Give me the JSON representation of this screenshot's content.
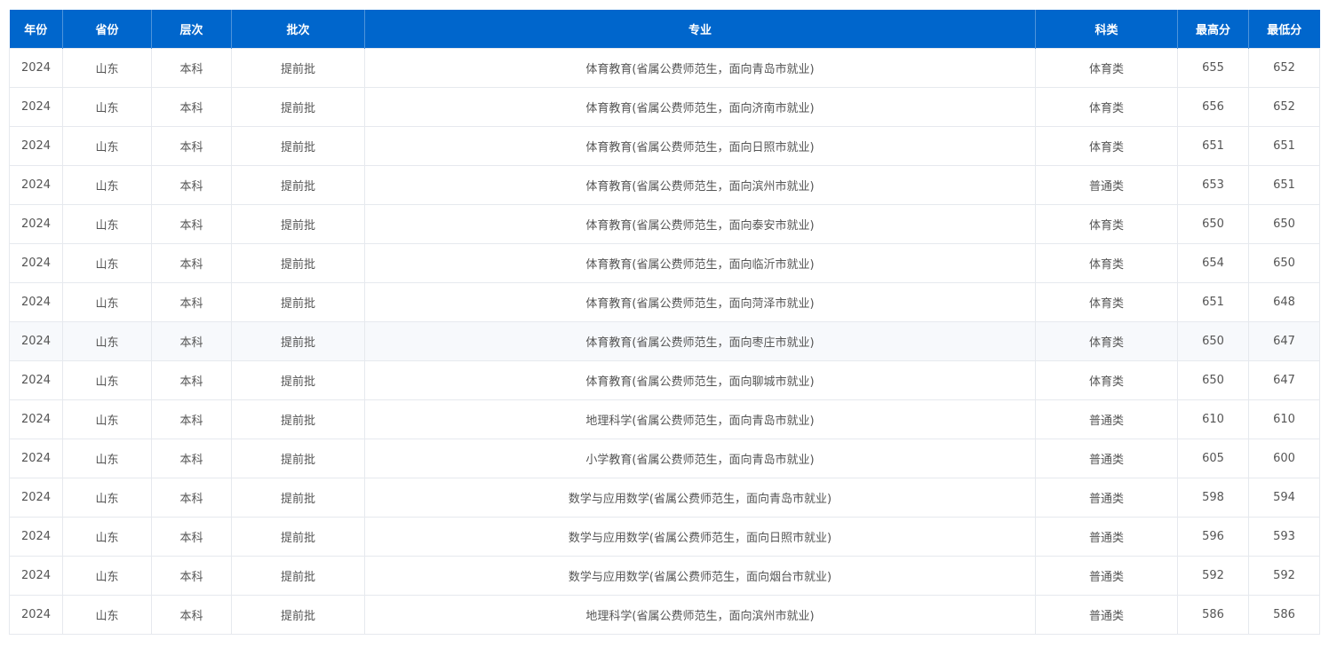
{
  "table": {
    "headers": [
      "年份",
      "省份",
      "层次",
      "批次",
      "专业",
      "科类",
      "最高分",
      "最低分"
    ],
    "rows": [
      [
        "2024",
        "山东",
        "本科",
        "提前批",
        "体育教育(省属公费师范生，面向青岛市就业)",
        "体育类",
        "655",
        "652"
      ],
      [
        "2024",
        "山东",
        "本科",
        "提前批",
        "体育教育(省属公费师范生，面向济南市就业)",
        "体育类",
        "656",
        "652"
      ],
      [
        "2024",
        "山东",
        "本科",
        "提前批",
        "体育教育(省属公费师范生，面向日照市就业)",
        "体育类",
        "651",
        "651"
      ],
      [
        "2024",
        "山东",
        "本科",
        "提前批",
        "体育教育(省属公费师范生，面向滨州市就业)",
        "普通类",
        "653",
        "651"
      ],
      [
        "2024",
        "山东",
        "本科",
        "提前批",
        "体育教育(省属公费师范生，面向泰安市就业)",
        "体育类",
        "650",
        "650"
      ],
      [
        "2024",
        "山东",
        "本科",
        "提前批",
        "体育教育(省属公费师范生，面向临沂市就业)",
        "体育类",
        "654",
        "650"
      ],
      [
        "2024",
        "山东",
        "本科",
        "提前批",
        "体育教育(省属公费师范生，面向菏泽市就业)",
        "体育类",
        "651",
        "648"
      ],
      [
        "2024",
        "山东",
        "本科",
        "提前批",
        "体育教育(省属公费师范生，面向枣庄市就业)",
        "体育类",
        "650",
        "647"
      ],
      [
        "2024",
        "山东",
        "本科",
        "提前批",
        "体育教育(省属公费师范生，面向聊城市就业)",
        "体育类",
        "650",
        "647"
      ],
      [
        "2024",
        "山东",
        "本科",
        "提前批",
        "地理科学(省属公费师范生，面向青岛市就业)",
        "普通类",
        "610",
        "610"
      ],
      [
        "2024",
        "山东",
        "本科",
        "提前批",
        "小学教育(省属公费师范生，面向青岛市就业)",
        "普通类",
        "605",
        "600"
      ],
      [
        "2024",
        "山东",
        "本科",
        "提前批",
        "数学与应用数学(省属公费师范生，面向青岛市就业)",
        "普通类",
        "598",
        "594"
      ],
      [
        "2024",
        "山东",
        "本科",
        "提前批",
        "数学与应用数学(省属公费师范生，面向日照市就业)",
        "普通类",
        "596",
        "593"
      ],
      [
        "2024",
        "山东",
        "本科",
        "提前批",
        "数学与应用数学(省属公费师范生，面向烟台市就业)",
        "普通类",
        "592",
        "592"
      ],
      [
        "2024",
        "山东",
        "本科",
        "提前批",
        "地理科学(省属公费师范生，面向滨州市就业)",
        "普通类",
        "586",
        "586"
      ]
    ]
  }
}
